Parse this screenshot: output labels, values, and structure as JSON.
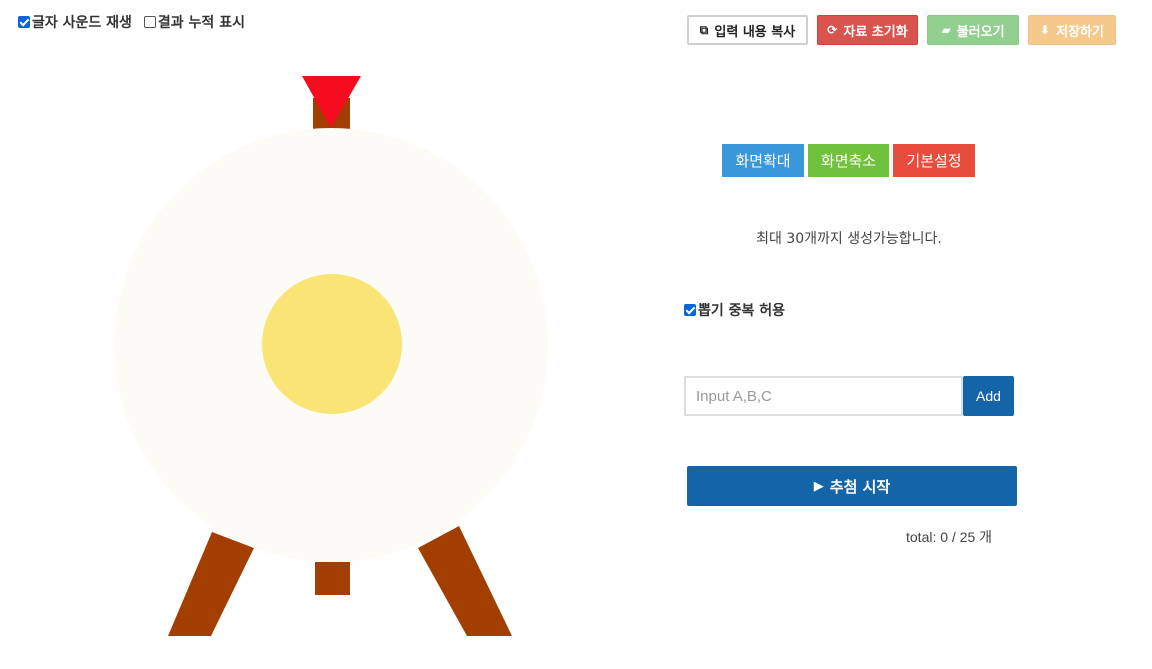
{
  "options": {
    "sound": {
      "label": "글자 사운드 재생",
      "checked": true
    },
    "accumulate": {
      "label": "결과 누적 표시",
      "checked": false
    }
  },
  "toolbar": {
    "copy_label": "입력 내용 복사",
    "reset_label": "자료 초기화",
    "load_label": "불러오기",
    "save_label": "저장하기"
  },
  "zoom": {
    "zoom_in": "화면확대",
    "zoom_out": "화면축소",
    "default": "기본설정"
  },
  "limit_text": "최대 30개까지 생성가능합니다.",
  "duplicate": {
    "label": "뽑기 중복 허용",
    "checked": true
  },
  "input": {
    "placeholder": "Input A,B,C",
    "value": ""
  },
  "add_label": "Add",
  "start_label": "추첨 시작",
  "total_text": "total: 0 / 25 개",
  "colors": {
    "board": "#fcfbf5",
    "center": "#f9e475",
    "stand": "#a23f00",
    "pointer": "#f60c1f",
    "primary": "#1464a8"
  },
  "icons": {
    "copy": "copy-icon",
    "reset": "refresh-icon",
    "load": "folder-open-icon",
    "save": "download-icon",
    "start": "play-icon"
  }
}
